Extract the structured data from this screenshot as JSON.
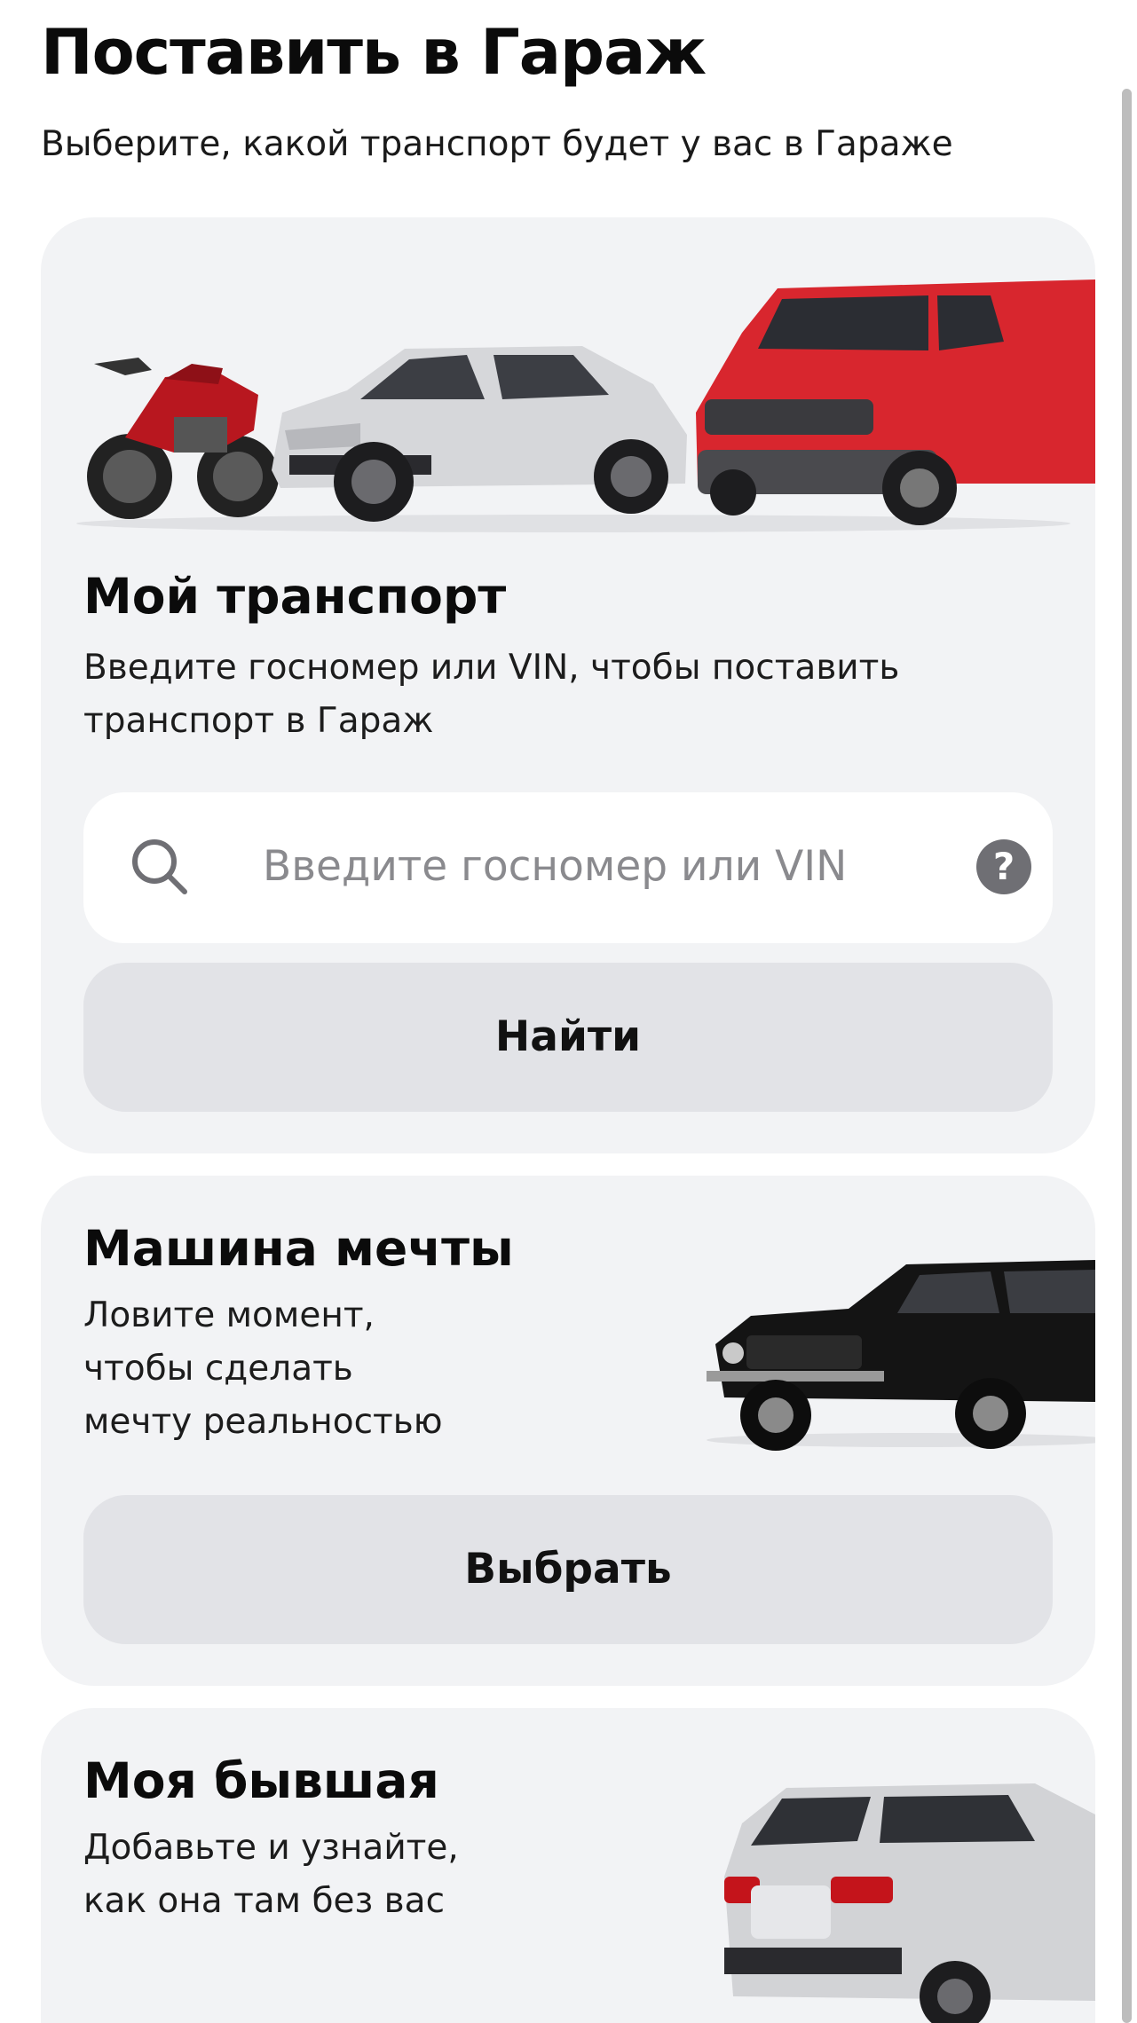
{
  "header": {
    "title": "Поставить в Гараж",
    "subtitle": "Выберите, какой транспорт будет у вас в Гараже"
  },
  "my_transport": {
    "title": "Мой транспорт",
    "description": "Введите госномер или VIN, чтобы поставить\nтранспорт в Гараж",
    "search_placeholder": "Введите госномер или VIN",
    "help_symbol": "?",
    "find_button": "Найти",
    "images": [
      "motorcycle",
      "silver-hatchback",
      "red-van"
    ]
  },
  "dream_car": {
    "title": "Машина мечты",
    "description": "Ловите момент,\nчтобы сделать\nмечту реальностью",
    "choose_button": "Выбрать",
    "image": "black-classic-car"
  },
  "ex_car": {
    "title": "Моя бывшая",
    "description": "Добавьте и узнайте,\nкак она там без вас",
    "image": "silver-suv"
  },
  "colors": {
    "card_bg": "#f2f3f5",
    "button_bg": "#e2e3e7",
    "van_red": "#d8262e",
    "moto_red": "#b8171f",
    "silver": "#d6d7da",
    "black_car": "#141414"
  }
}
